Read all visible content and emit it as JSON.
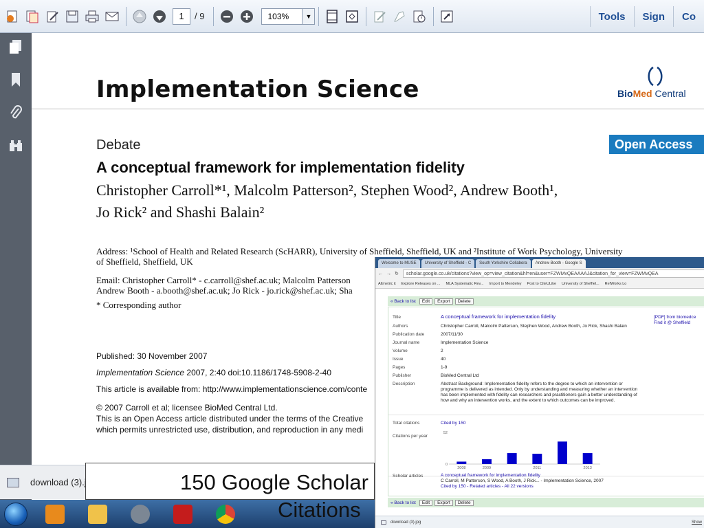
{
  "toolbar": {
    "page_current": "1",
    "page_total": "/ 9",
    "zoom": "103%",
    "links": [
      "Tools",
      "Sign",
      "Co"
    ]
  },
  "document": {
    "journal_title": "Implementation Science",
    "publisher_logo": {
      "bio": "Bio",
      "med": "Med",
      "central": " Central"
    },
    "open_access": "Open Access",
    "article_type": "Debate",
    "title": "A conceptual framework for implementation fidelity",
    "authors_line1": "Christopher Carroll*¹, Malcolm Patterson², Stephen Wood², Andrew Booth¹,",
    "authors_line2": "Jo Rick² and Shashi Balain²",
    "address_line1": "Address: ¹School of Health and Related Research (ScHARR), University of Sheffield, Sheffield, UK and ²Institute of Work Psychology, University",
    "address_line2": "of Sheffield, Sheffield, UK",
    "email_line1": "Email: Christopher Carroll* - c.carroll@shef.ac.uk; Malcolm Patterson",
    "email_line2": "Andrew Booth - a.booth@shef.ac.uk; Jo Rick - jo.rick@shef.ac.uk; Sha",
    "corresponding": "* Corresponding author",
    "published": "Published: 30 November 2007",
    "citation_journal": "Implementation Science",
    "citation_rest": " 2007, 2:40    doi:10.1186/1748-5908-2-40",
    "available": "This article is available from: http://www.implementationscience.com/conte",
    "copyright_line1": "© 2007 Carroll et al; licensee BioMed Central Ltd.",
    "copyright_line2": "This is an Open Access article distributed under the terms of the Creative",
    "copyright_line3": "which permits unrestricted use, distribution, and reproduction in any medi"
  },
  "inset": {
    "tabs": [
      "Welcome to MUSE",
      "University of Sheffield - C",
      "South Yorkshire Collabora",
      "Andrew Booth - Google S"
    ],
    "url": "scholar.google.co.uk/citations?view_op=view_citation&hl=en&user=FZWMvQEAAAAJ&citation_for_view=FZWMvQEA",
    "bookmarks": [
      "Altmetric it",
      "Explore Releases on ...",
      "MLA Systematic Rev...",
      "Import to Mendeley",
      "Post to CiteULike",
      "University of Sheffiel...",
      "RefWorks Lo"
    ],
    "bar": {
      "back": "« Back to list",
      "edit": "Edit",
      "export": "Export",
      "delete": "Delete"
    },
    "fields": {
      "title_label": "Title",
      "title_value": "A conceptual framework for implementation fidelity",
      "authors_label": "Authors",
      "authors_value": "Christopher Carroll, Malcolm Patterson, Stephen Wood, Andrew Booth, Jo Rick, Shashi Balain",
      "date_label": "Publication date",
      "date_value": "2007/11/30",
      "journal_label": "Journal name",
      "journal_value": "Implementation Science",
      "volume_label": "Volume",
      "volume_value": "2",
      "issue_label": "Issue",
      "issue_value": "40",
      "pages_label": "Pages",
      "pages_value": "1-9",
      "publisher_label": "Publisher",
      "publisher_value": "BioMed Central Ltd",
      "description_label": "Description",
      "description_value": "Abstract Background: Implementation fidelity refers to the degree to which an intervention or programme is delivered as intended. Only by understanding and measuring whether an intervention has been implemented with fidelity can researchers and practitioners gain a better understanding of how and why an intervention works, and the extent to which outcomes can be improved.",
      "total_label": "Total citations",
      "total_value": "Cited by 150",
      "per_year_label": "Citations per year",
      "articles_label": "Scholar articles",
      "articles_title": "A conceptual framework for implementation fidelity",
      "articles_meta": "C Carroll, M Patterson, S Wood, A Booth, J Rick... - Implementation Science, 2007",
      "articles_links": "Cited by 150 - Related articles - All 22 versions"
    },
    "side_links": [
      "[PDF] from biomedce",
      "Find it @ Sheffield"
    ],
    "download_file": "download (3).jpg",
    "show_all": "Show"
  },
  "chart_data": {
    "type": "bar",
    "categories": [
      "2008",
      "2009",
      "2010",
      "2011",
      "2012",
      "2013"
    ],
    "values": [
      4,
      8,
      18,
      17,
      37,
      18
    ],
    "x_tick_labels": [
      "2008",
      "2009",
      "2011",
      "2013"
    ],
    "y_tick_labels": [
      "52",
      "0"
    ],
    "ylim": [
      0,
      52
    ],
    "grid": false,
    "bar_color": "#0000cc"
  },
  "download_bar": {
    "file": "download (3).j"
  },
  "caption": {
    "line1": "150 Google Scholar",
    "line2": "Citations"
  }
}
